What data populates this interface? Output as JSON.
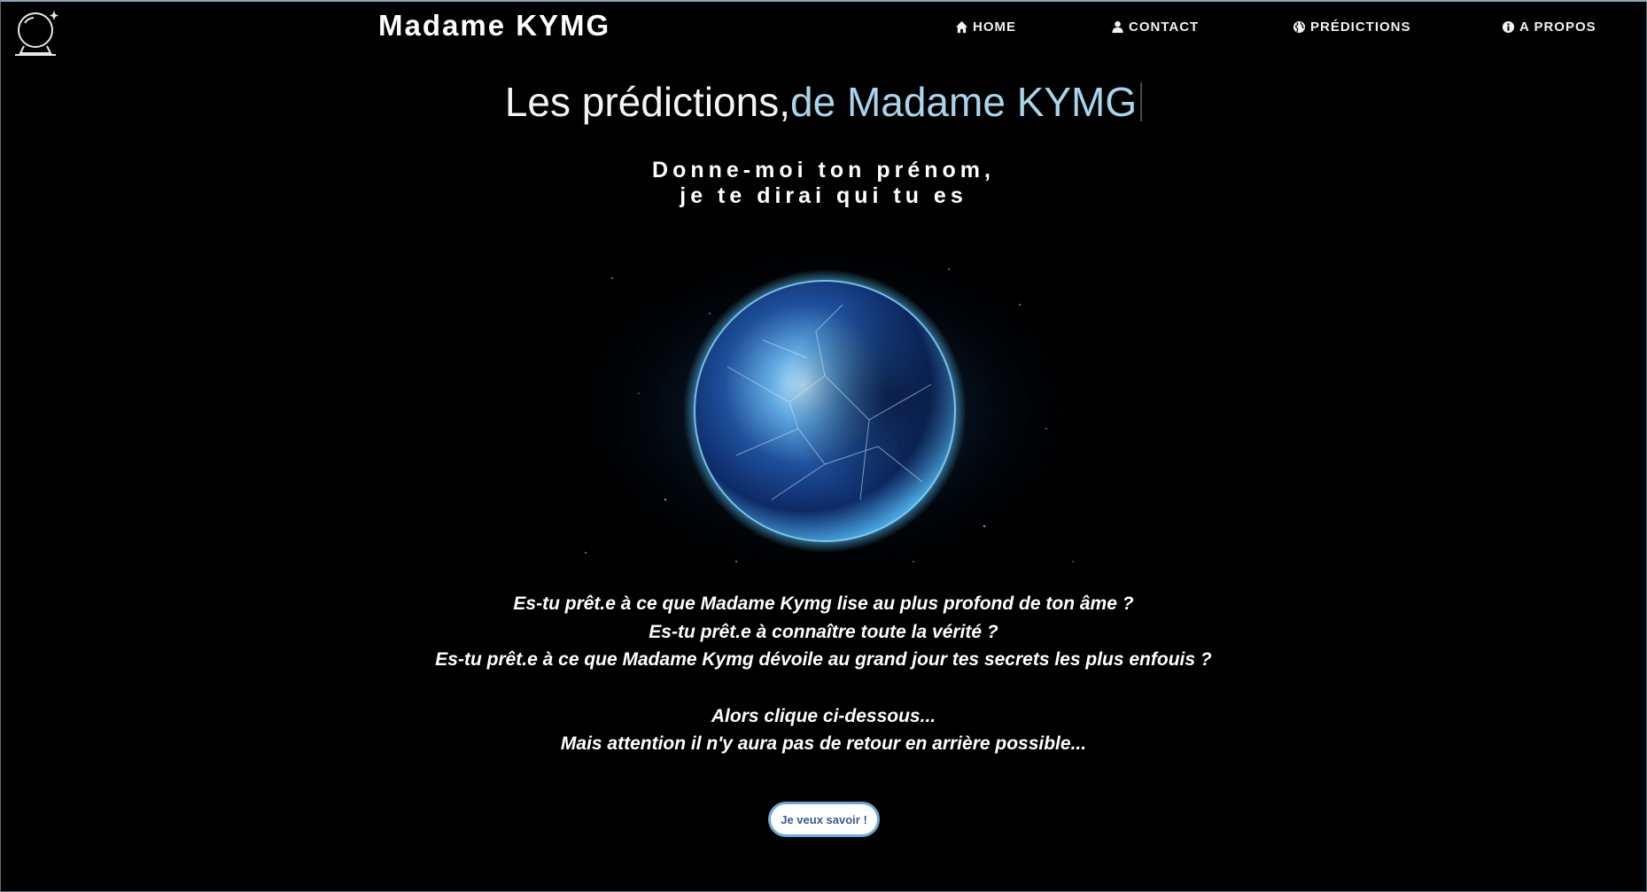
{
  "brand": {
    "name": "Madame KYMG",
    "logo_icon": "crystal-ball-icon"
  },
  "nav": [
    {
      "id": "home",
      "label": "HOME",
      "icon": "home-icon"
    },
    {
      "id": "contact",
      "label": "CONTACT",
      "icon": "user-icon"
    },
    {
      "id": "predictions",
      "label": "PRÉDICTIONS",
      "icon": "globe-icon"
    },
    {
      "id": "apropos",
      "label": "A PROPOS",
      "icon": "info-icon"
    }
  ],
  "hero": {
    "title_main": "Les prédictions,",
    "title_accent": "de Madame KYMG",
    "tagline_line1": "Donne-moi ton prénom,",
    "tagline_line2": "je te dirai qui tu es"
  },
  "message": {
    "line1": "Es-tu prêt.e à ce que Madame Kymg lise au plus profond de ton âme ?",
    "line2": "Es-tu prêt.e à connaître toute la vérité ?",
    "line3": "Es-tu prêt.e à ce que Madame Kymg dévoile au grand jour tes secrets les plus enfouis ?",
    "line4": "Alors clique ci-dessous...",
    "line5": "Mais attention il n'y aura pas de retour en arrière possible..."
  },
  "cta": {
    "label": "Je veux savoir !"
  },
  "colors": {
    "background": "#000000",
    "accent_title": "#a9d4ea",
    "button_border": "#6fa8d8",
    "button_text": "#3a5a8a"
  }
}
